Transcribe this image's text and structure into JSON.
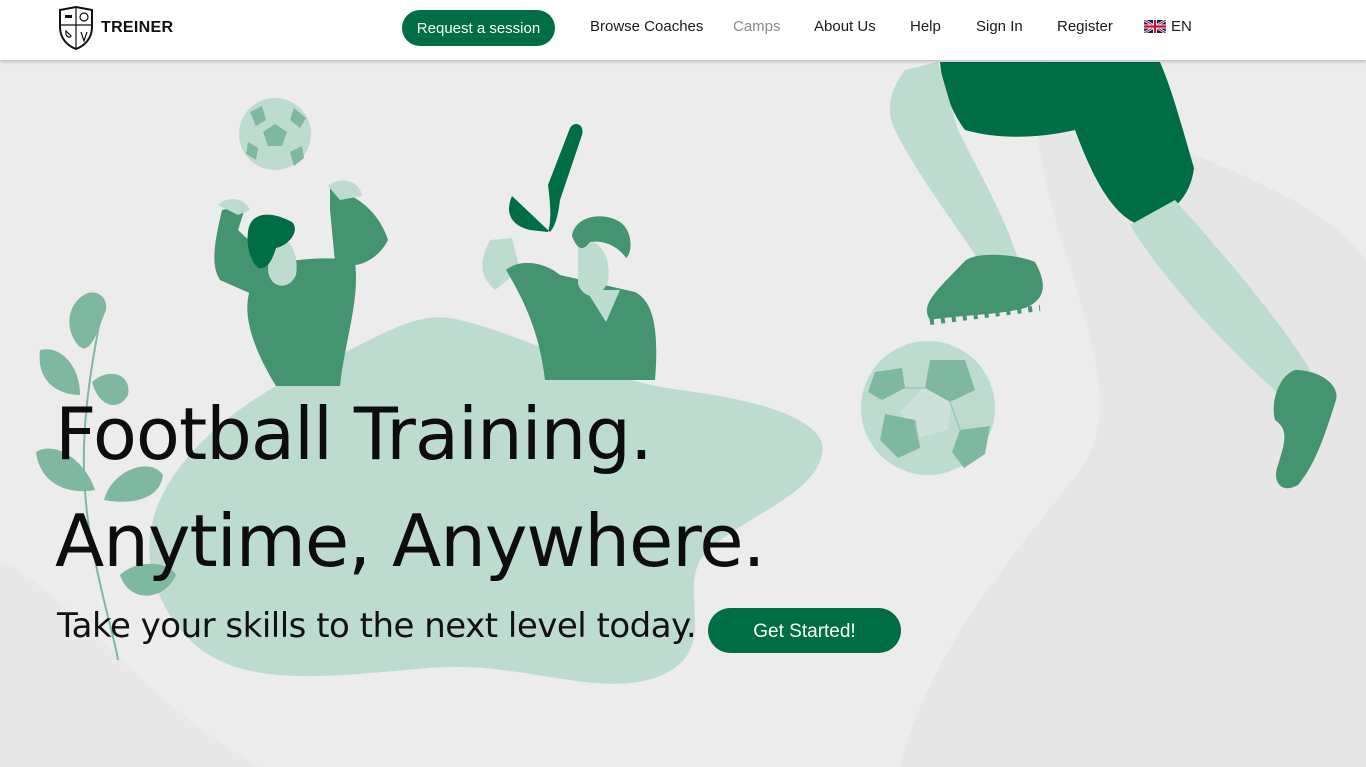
{
  "brand": {
    "name": "TREINER"
  },
  "nav": {
    "request_label": "Request a session",
    "links": [
      {
        "label": "Browse Coaches"
      },
      {
        "label": "Camps"
      },
      {
        "label": "About Us"
      },
      {
        "label": "Help"
      },
      {
        "label": "Sign In"
      },
      {
        "label": "Register"
      }
    ],
    "language": "EN",
    "language_icon": "uk-flag-icon"
  },
  "hero": {
    "title_line1": "Football Training.",
    "title_line2": "Anytime, Anywhere.",
    "subtitle": "Take your skills to the next level today.",
    "cta_label": "Get Started!"
  },
  "colors": {
    "brand_green": "#006e45",
    "mid_green": "#44946f",
    "light_green": "#bedbd0",
    "leaf_green": "#7fb8a1",
    "background": "#ececec"
  }
}
